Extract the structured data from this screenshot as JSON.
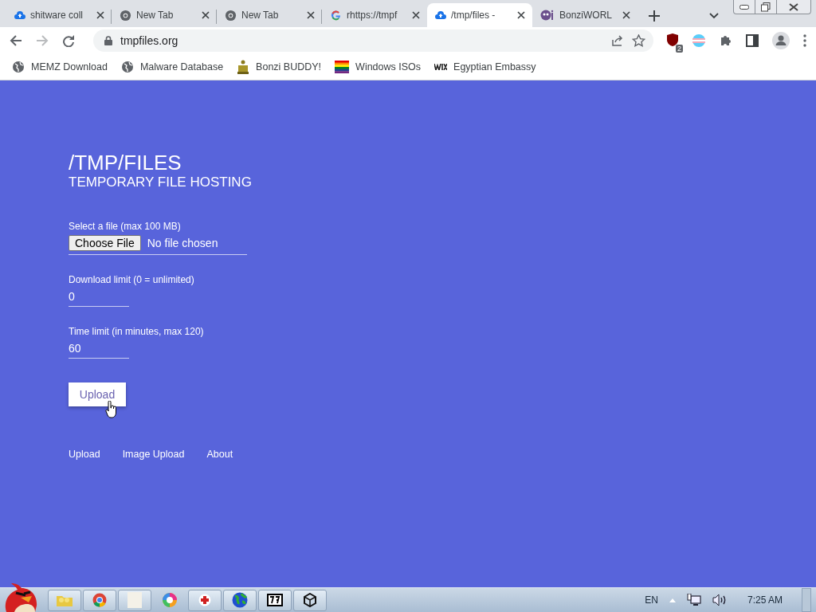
{
  "browser": {
    "tabs": [
      {
        "title": "shitware coll",
        "selected": false
      },
      {
        "title": "New Tab",
        "selected": false
      },
      {
        "title": "New Tab",
        "selected": false
      },
      {
        "title": "rhttps://tmpf",
        "selected": false
      },
      {
        "title": "/tmp/files -",
        "selected": true
      },
      {
        "title": "BonziWORL",
        "selected": false
      }
    ],
    "address": "tmpfiles.org",
    "extension_badge": "2",
    "bookmarks": [
      "MEMZ Download",
      "Malware Database",
      "Bonzi BUDDY!",
      "Windows ISOs",
      "Egyptian Embassy"
    ]
  },
  "page": {
    "title": "/TMP/FILES",
    "subtitle": "TEMPORARY FILE HOSTING",
    "file_field": {
      "label": "Select a file (max 100 MB)",
      "button": "Choose File",
      "status": "No file chosen"
    },
    "fields": [
      {
        "label": "Download limit (0 = unlimited)",
        "value": "0"
      },
      {
        "label": "Time limit (in minutes, max 120)",
        "value": "60"
      }
    ],
    "submit": "Upload",
    "links": [
      "Upload",
      "Image Upload",
      "About"
    ]
  },
  "taskbar": {
    "language": "EN",
    "clock": "7:25 AM"
  }
}
